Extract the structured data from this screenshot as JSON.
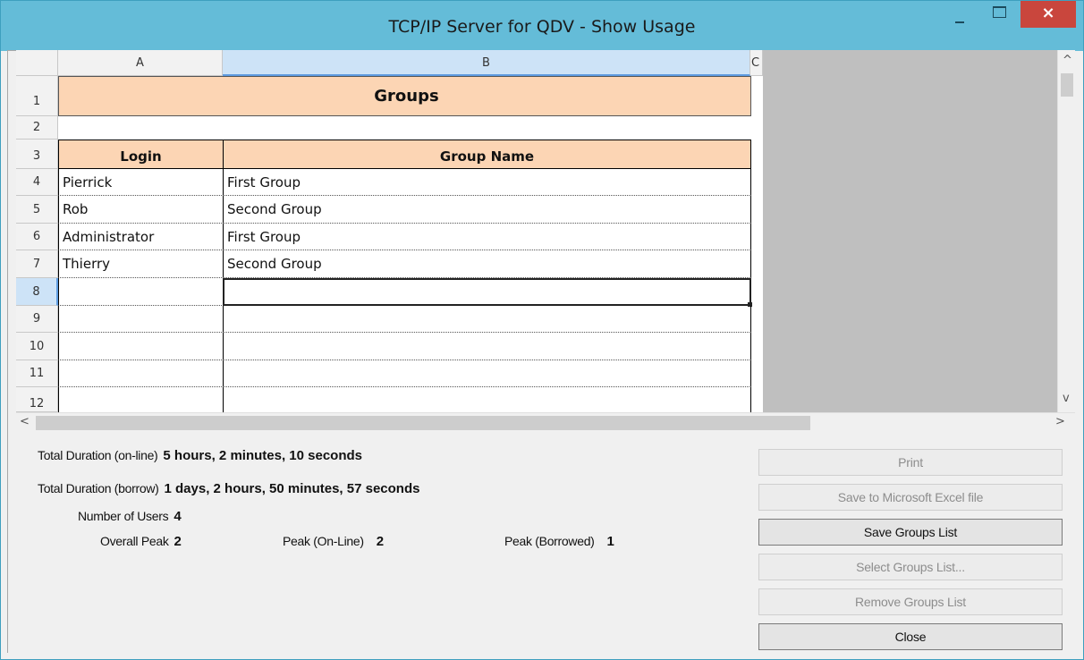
{
  "window": {
    "title": "TCP/IP Server for QDV - Show Usage",
    "close_glyph": "×"
  },
  "sheet": {
    "corner": "",
    "columns": [
      "A",
      "B",
      "C"
    ],
    "selected_column": "B",
    "rows": [
      "1",
      "2",
      "3",
      "4",
      "5",
      "6",
      "7",
      "8",
      "9",
      "10",
      "11",
      "12"
    ],
    "selected_row": "8",
    "title": "Groups",
    "headers": {
      "login": "Login",
      "group_name": "Group Name"
    },
    "data": [
      {
        "login": "Pierrick",
        "group": "First Group"
      },
      {
        "login": "Rob",
        "group": "Second Group"
      },
      {
        "login": "Administrator",
        "group": "First Group"
      },
      {
        "login": "Thierry",
        "group": "Second Group"
      }
    ],
    "title_fill_color": "#fcd5b4"
  },
  "scroll": {
    "up_arrow": "^",
    "down_arrow": "v",
    "left_arrow": "<",
    "right_arrow": ">"
  },
  "stats": {
    "online_label": "Total Duration (on-line)",
    "online_value": "5 hours, 2 minutes, 10 seconds",
    "borrow_label": "Total Duration (borrow)",
    "borrow_value": "1 days, 2 hours, 50 minutes, 57 seconds",
    "users_label": "Number of Users",
    "users_value": "4",
    "overall_peak_label": "Overall Peak",
    "overall_peak_value": "2",
    "peak_online_label": "Peak (On-Line)",
    "peak_online_value": "2",
    "peak_borrowed_label": "Peak (Borrowed)",
    "peak_borrowed_value": "1"
  },
  "buttons": {
    "print": "Print",
    "save_excel": "Save to Microsoft Excel file",
    "save_groups": "Save Groups List",
    "select_groups": "Select Groups List...",
    "remove_groups": "Remove Groups List",
    "close": "Close"
  },
  "colors": {
    "titlebar": "#64bcd8",
    "close_button": "#c9463d",
    "header_fill": "#fcd5b4",
    "selection": "#cde3f7"
  }
}
